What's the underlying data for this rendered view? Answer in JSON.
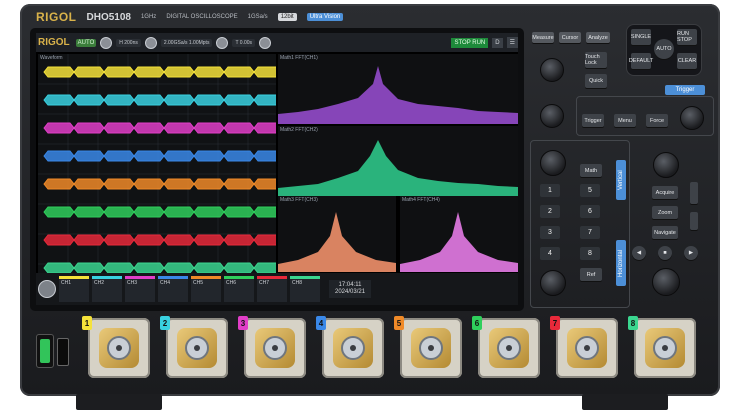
{
  "device": {
    "brand": "RIGOL",
    "model": "DHO5108",
    "bandwidth": "1GHz",
    "description": "DIGITAL OSCILLOSCOPE",
    "sample_rate": "1GSa/s",
    "bits": "12bit",
    "badge": "Ultra Vision"
  },
  "screen": {
    "brand": "RIGOL",
    "auto": "AUTO",
    "chips": [
      "H 200ns",
      "2.00GSa/s 1.00Mpts",
      "T 0.00s"
    ],
    "run_state": "STOP RUN",
    "d_label": "D",
    "panel_titles": [
      "Waveform",
      "Math1 FFT(CH1)",
      "Math2 FFT(CH2)",
      "Math3 FFT(CH3)",
      "Math4 FFT(CH4)"
    ],
    "time_readout": [
      "17:04:11",
      "2024/03/21"
    ],
    "channels": [
      {
        "label": "CH1",
        "color": "#f5e23a"
      },
      {
        "label": "CH2",
        "color": "#39d1e0"
      },
      {
        "label": "CH3",
        "color": "#e23ec8"
      },
      {
        "label": "CH4",
        "color": "#3a88e8"
      },
      {
        "label": "CH5",
        "color": "#f08a28"
      },
      {
        "label": "CH6",
        "color": "#2fcf5c"
      },
      {
        "label": "CH7",
        "color": "#e8293a"
      },
      {
        "label": "CH8",
        "color": "#3ad68f"
      }
    ]
  },
  "panel": {
    "buttons": {
      "measure": "Measure",
      "cursor": "Cursor",
      "analyze": "Analyze",
      "touch_lock": "Touch Lock",
      "quick": "Quick",
      "single": "SINGLE",
      "auto": "AUTO",
      "run_stop": "RUN STOP",
      "default": "DEFAULT",
      "clear": "CLEAR",
      "trigger": "Trigger",
      "menu": "Menu",
      "force": "Force",
      "math": "Math",
      "ref": "Ref",
      "acquire": "Acquire",
      "zoom": "Zoom",
      "navigate": "Navigate",
      "trigger_label": "Trigger",
      "vertical_label": "Vertical",
      "horizontal_label": "Horizontal"
    },
    "channel_keys": [
      "1",
      "2",
      "3",
      "4",
      "5",
      "6",
      "7",
      "8"
    ]
  },
  "inputs": {
    "bnc_tags": [
      "1",
      "2",
      "3",
      "4",
      "5",
      "6",
      "7",
      "8"
    ]
  }
}
